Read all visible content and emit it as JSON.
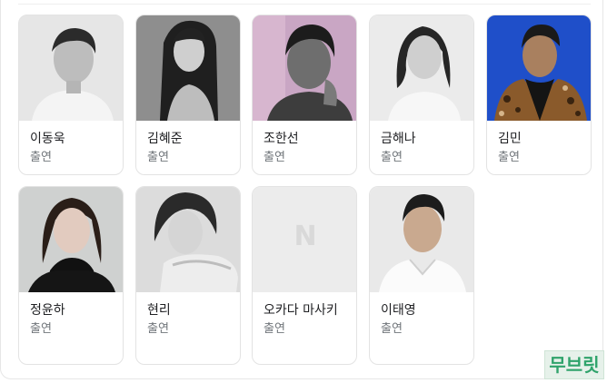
{
  "cast": [
    {
      "name": "이동욱",
      "role": "출연",
      "photo": "portrait-bw-man"
    },
    {
      "name": "김혜준",
      "role": "출연",
      "photo": "portrait-bw-woman"
    },
    {
      "name": "조한선",
      "role": "출연",
      "photo": "portrait-pink-man"
    },
    {
      "name": "금해나",
      "role": "출연",
      "photo": "portrait-bw-woman-short-hair"
    },
    {
      "name": "김민",
      "role": "출연",
      "photo": "portrait-blue-leopard-coat"
    },
    {
      "name": "정윤하",
      "role": "출연",
      "photo": "portrait-gray-woman"
    },
    {
      "name": "현리",
      "role": "출연",
      "photo": "portrait-bw-woman-pose"
    },
    {
      "name": "오카다 마사키",
      "role": "출연",
      "photo": "placeholder-n-icon"
    },
    {
      "name": "이태영",
      "role": "출연",
      "photo": "portrait-man-white-shirt"
    }
  ],
  "placeholder_glyph": "N",
  "watermark": "무브릿",
  "colors": {
    "name": "#202124",
    "role": "#70757a",
    "placeholder_bg": "#ececec",
    "placeholder_glyph": "#d9d9d9",
    "watermark": "#2fa36b"
  }
}
